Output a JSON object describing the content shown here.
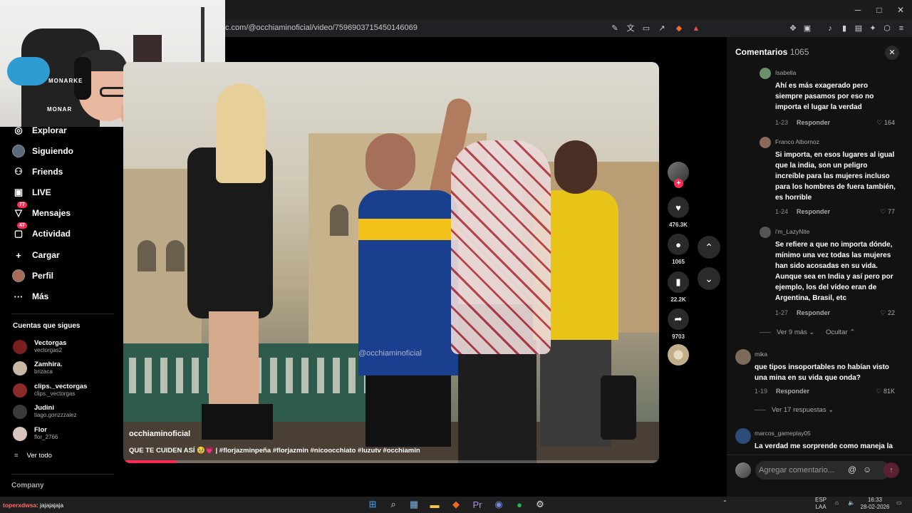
{
  "browser": {
    "url": "c.com/@occhiaminoficial/video/7596903715450146069",
    "window_controls": [
      "─",
      "□",
      "✕"
    ]
  },
  "sidebar": {
    "items": [
      {
        "label": "Explorar",
        "icon": "compass-icon",
        "glyph": "◎"
      },
      {
        "label": "Siguiendo",
        "icon": "avatar-icon",
        "glyph": ""
      },
      {
        "label": "Friends",
        "icon": "friends-icon",
        "glyph": "👥"
      },
      {
        "label": "LIVE",
        "icon": "live-icon",
        "glyph": "▣"
      },
      {
        "label": "Mensajes",
        "icon": "messages-icon",
        "glyph": "▽",
        "badge": "77"
      },
      {
        "label": "Actividad",
        "icon": "activity-icon",
        "glyph": "▢",
        "badge": "47"
      },
      {
        "label": "Cargar",
        "icon": "upload-icon",
        "glyph": "+"
      },
      {
        "label": "Perfil",
        "icon": "profile-icon",
        "glyph": ""
      },
      {
        "label": "Más",
        "icon": "more-icon",
        "glyph": "···"
      }
    ],
    "following_title": "Cuentas que sigues",
    "accounts": [
      {
        "name": "Vectorgas",
        "user": "vectorgas2",
        "color": "#7a1f1f"
      },
      {
        "name": "Zamhira.",
        "user": "brizaca",
        "color": "#c9b7a6"
      },
      {
        "name": "clips._vectorgas",
        "user": "clips._vectorgas",
        "color": "#8a2a2a"
      },
      {
        "name": "Judini",
        "user": "tiago.gonzzzalez",
        "color": "#3a3a3a"
      },
      {
        "name": "Flor",
        "user": "flor_2766",
        "color": "#d9c4bb"
      }
    ],
    "see_all": "Ver todo",
    "company": "Company"
  },
  "webcam": {
    "chair_brand": "MONARKE",
    "chair_brand2": "MONAR"
  },
  "video": {
    "watermark": "@occhiaminoficial",
    "username": "occhiaminoficial",
    "caption": "QUE TE CUIDEN ASÍ 🥹💗 | #florjazminpeña #florjazmin #nicoocchiato #luzutv #occhiamin",
    "progress": 0.1
  },
  "actions": {
    "likes": "476.3K",
    "comments": "1065",
    "saves": "22.2K",
    "shares": "9703"
  },
  "comments_panel": {
    "title": "Comentarios",
    "count": "1065",
    "comments": [
      {
        "name": "Isabella",
        "text": "Ahí es más exagerado pero siempre pasamos por eso no importa el lugar la verdad",
        "date": "1-23",
        "reply": "Responder",
        "likes": "164"
      },
      {
        "name": "Franco Albornoz",
        "text": "Si importa, en esos lugares al igual que la india, son un peligro increíble para las mujeres incluso para los hombres de fuera también, es horrible",
        "date": "1-24",
        "reply": "Responder",
        "likes": "77"
      },
      {
        "name": "i'm_LazyNite",
        "text": "Se refiere a que no importa dónde, mínimo una vez todas las mujeres han sido acosadas en su vida. Aunque sea en India y así pero por ejemplo, los del vídeo eran de Argentina, Brasil, etc",
        "date": "1-27",
        "reply": "Responder",
        "likes": "22"
      },
      {
        "name": "mika",
        "text": "que tipos insoportables no habían visto una mina en su vida que onda?",
        "date": "1-19",
        "reply": "Responder",
        "likes": "81K"
      },
      {
        "name": "marcos_gameplay05",
        "text": "La verdad me sorprende como maneja la"
      }
    ],
    "view_more": "Ver 9 más",
    "hide": "Ocultar",
    "view_replies": "Ver 17 respuestas",
    "input_placeholder": "Agregar comentario..."
  },
  "taskbar": {
    "chat_user": "toperxdwsa",
    "chat_msg": ": jajajajaja",
    "lang": "ESP",
    "lang2": "LAA",
    "time": "16:33",
    "date": "28-02-2026"
  }
}
